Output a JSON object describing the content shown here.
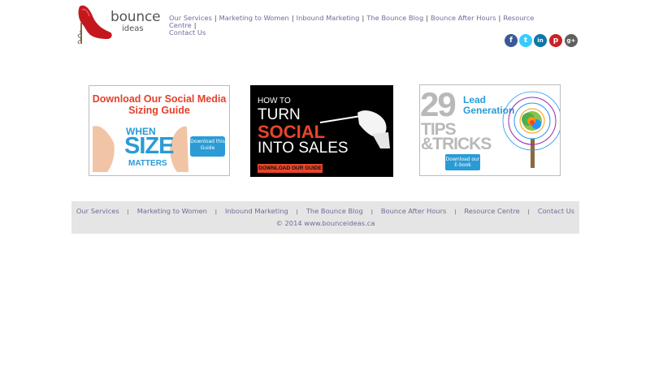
{
  "logo": {
    "name": "bounce",
    "sub": "ideas"
  },
  "nav": {
    "items": [
      "Our Services",
      "Marketing to Women",
      "Inbound Marketing",
      "The Bounce Blog",
      "Bounce After Hours",
      "Resource Centre",
      "Contact Us"
    ]
  },
  "social": [
    {
      "icon": "facebook-icon",
      "glyph": "f",
      "color": "#3b5998"
    },
    {
      "icon": "twitter-icon",
      "glyph": "t",
      "color": "#33ccff"
    },
    {
      "icon": "linkedin-icon",
      "glyph": "in",
      "color": "#0e76a8"
    },
    {
      "icon": "pinterest-icon",
      "glyph": "p",
      "color": "#cb2027"
    },
    {
      "icon": "googleplus-icon",
      "glyph": "g+",
      "color": "#5f5f5f"
    }
  ],
  "banners": {
    "social_media": {
      "headline": "Download Our Social Media Sizing Guide",
      "big1": "WHEN",
      "big2": "SIZE",
      "big3": "MATTERS",
      "cta": "Download this Guide"
    },
    "social_sales": {
      "line1": "HOW TO",
      "line2": "TURN",
      "line3": "SOCIAL",
      "line4": "INTO SALES",
      "cta": "DOWNLOAD OUR GUIDE"
    },
    "lead_gen": {
      "number": "29",
      "title1": "Lead",
      "title2": "Generation",
      "tips1": "TIPS",
      "tips2": "&TRICKS",
      "cta": "Download our E-book"
    }
  },
  "footer": {
    "copyright": "© 2014 www.bounceideas.ca"
  }
}
